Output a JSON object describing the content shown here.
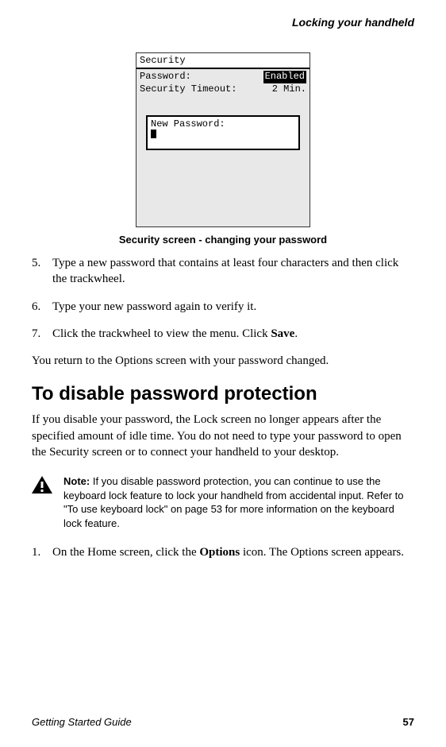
{
  "header": "Locking your handheld",
  "screenshot": {
    "title": "Security",
    "row1_label": "Password:",
    "row1_value": "Enabled",
    "row2_label": "Security Timeout:",
    "row2_value": "2 Min.",
    "dialog_label": "New Password:"
  },
  "caption": "Security screen - changing your password",
  "steps": [
    {
      "num": "5.",
      "text_before": "Type a new password that contains at least four characters and then click the trackwheel."
    },
    {
      "num": "6.",
      "text_before": "Type your new password again to verify it."
    },
    {
      "num": "7.",
      "text_before": "Click the trackwheel to view the menu. Click ",
      "bold": "Save",
      "text_after": "."
    }
  ],
  "para1": "You return to the Options screen with your password changed.",
  "heading": "To disable password protection",
  "para2": "If you disable your password, the Lock screen no longer appears after the specified amount of idle time. You do not need to type your password to open the Security screen or to connect your handheld to your desktop.",
  "note": {
    "label": "Note:",
    "text": " If you disable password protection, you can continue to use the keyboard lock feature to lock your handheld from accidental input. Refer to \"To use keyboard lock\" on page 53 for more information on the keyboard lock feature."
  },
  "step_d1": {
    "num": "1.",
    "before": "On the Home screen, click the ",
    "bold": "Options",
    "after": " icon. The Options screen appears."
  },
  "footer": {
    "left": "Getting Started Guide",
    "right": "57"
  }
}
